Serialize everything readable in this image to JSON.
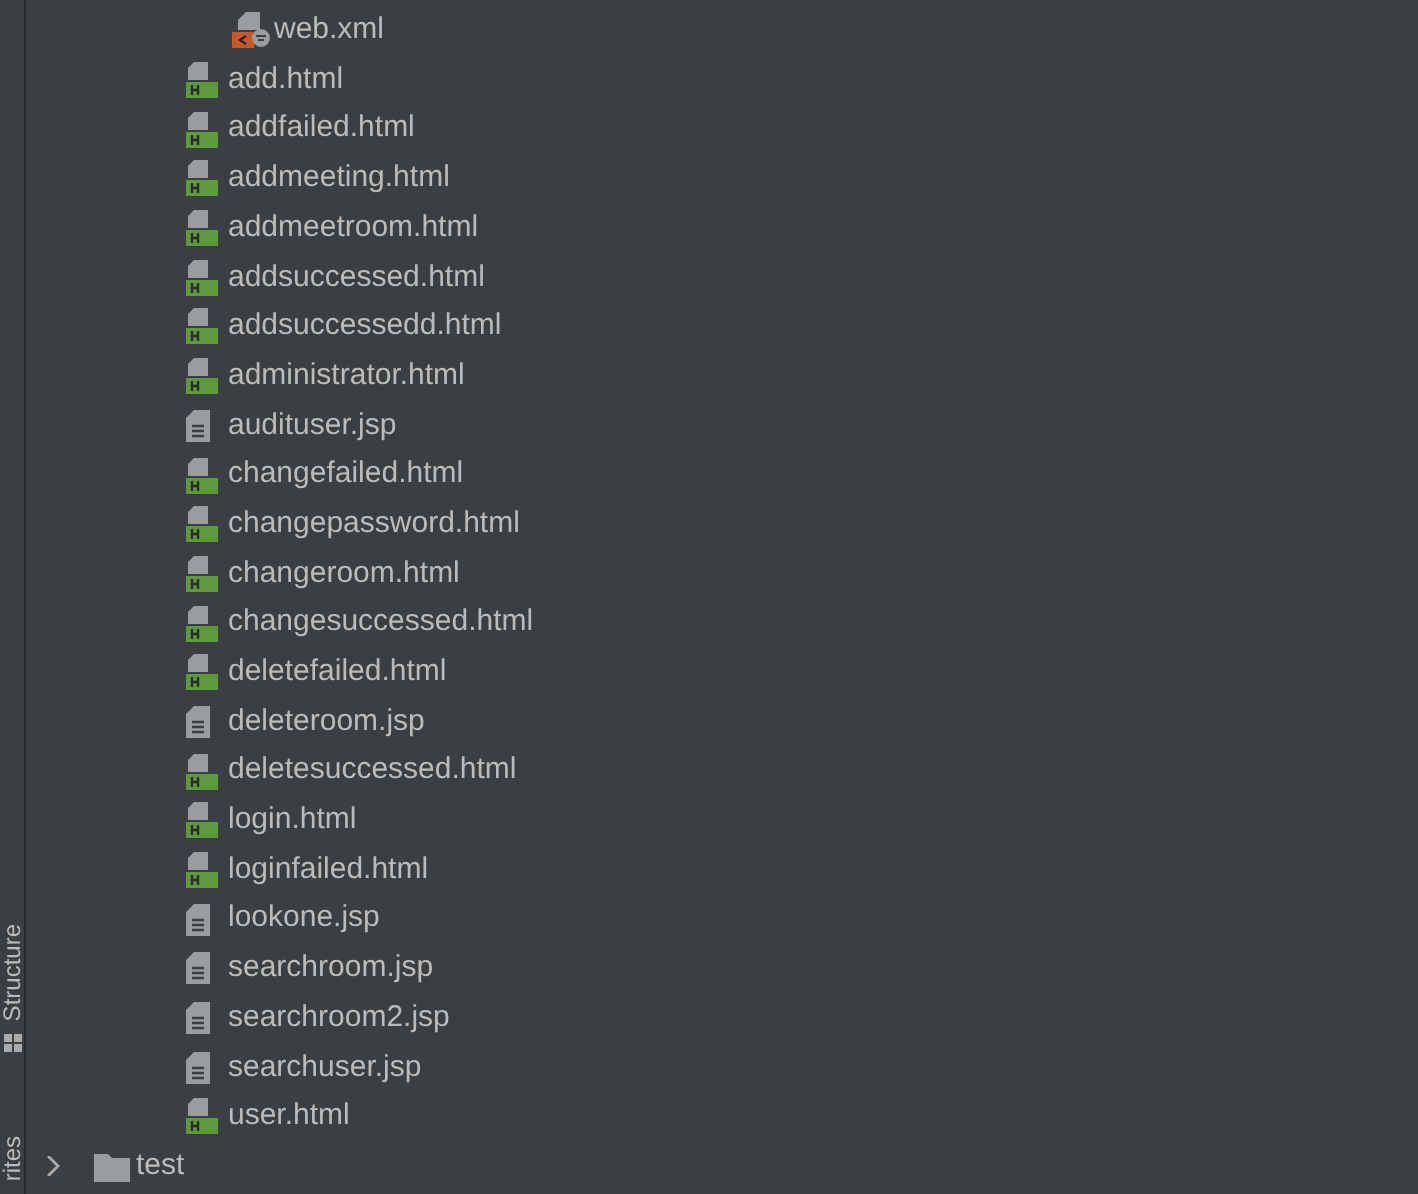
{
  "side_strip": {
    "tabs": [
      {
        "label": "Structure",
        "kind": "structure"
      },
      {
        "label": "rites",
        "kind": "plain"
      }
    ]
  },
  "tree": [
    {
      "kind": "group",
      "children": [
        {
          "kind": "group",
          "children": [
            {
              "kind": "group",
              "children": [
                {
                  "kind": "xml",
                  "label": "web.xml"
                }
              ]
            },
            {
              "kind": "html",
              "label": "add.html"
            },
            {
              "kind": "html",
              "label": "addfailed.html"
            },
            {
              "kind": "html",
              "label": "addmeeting.html"
            },
            {
              "kind": "html",
              "label": "addmeetroom.html"
            },
            {
              "kind": "html",
              "label": "addsuccessed.html"
            },
            {
              "kind": "html",
              "label": "addsuccessedd.html"
            },
            {
              "kind": "html",
              "label": "administrator.html"
            },
            {
              "kind": "jsp",
              "label": "audituser.jsp"
            },
            {
              "kind": "html",
              "label": "changefailed.html"
            },
            {
              "kind": "html",
              "label": "changepassword.html"
            },
            {
              "kind": "html",
              "label": "changeroom.html"
            },
            {
              "kind": "html",
              "label": "changesuccessed.html"
            },
            {
              "kind": "html",
              "label": "deletefailed.html"
            },
            {
              "kind": "jsp",
              "label": "deleteroom.jsp"
            },
            {
              "kind": "html",
              "label": "deletesuccessed.html"
            },
            {
              "kind": "html",
              "label": "login.html"
            },
            {
              "kind": "html",
              "label": "loginfailed.html"
            },
            {
              "kind": "jsp",
              "label": "lookone.jsp"
            },
            {
              "kind": "jsp",
              "label": "searchroom.jsp"
            },
            {
              "kind": "jsp",
              "label": "searchroom2.jsp"
            },
            {
              "kind": "jsp",
              "label": "searchuser.jsp"
            },
            {
              "kind": "html",
              "label": "user.html"
            }
          ]
        }
      ]
    },
    {
      "kind": "folder",
      "label": "test",
      "expanded": false
    }
  ]
}
